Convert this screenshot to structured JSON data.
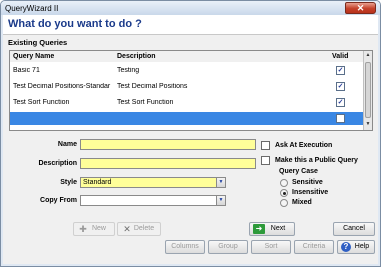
{
  "window": {
    "title": "QueryWizard II",
    "close_label": "✕"
  },
  "header": {
    "title": "What do you want to do ?"
  },
  "existing_queries": {
    "group_label": "Existing Queries",
    "columns": [
      "Query Name",
      "Description",
      "Valid"
    ],
    "rows": [
      {
        "name": "Basic 71",
        "description": "Testing",
        "valid": true
      },
      {
        "name": "Test Decimal Positions-Standar",
        "description": "Test Decimal Positions",
        "valid": true
      },
      {
        "name": "Test Sort Function",
        "description": "Test Sort Function",
        "valid": true
      },
      {
        "name": "",
        "description": "",
        "valid": false,
        "selected": true
      }
    ],
    "check_mark": "✓"
  },
  "form": {
    "name_label": "Name",
    "name_value": "",
    "description_label": "Description",
    "description_value": "",
    "style_label": "Style",
    "style_value": "Standard",
    "copy_from_label": "Copy From",
    "copy_from_value": ""
  },
  "options": {
    "ask_at_execution": "Ask At Execution",
    "public_query": "Make this a Public Query",
    "query_case_label": "Query Case",
    "query_case_options": [
      "Sensitive",
      "Insensitive",
      "Mixed"
    ],
    "query_case_selected": "Insensitive"
  },
  "buttons": {
    "new": "New",
    "delete": "Delete",
    "next": "Next",
    "cancel": "Cancel",
    "columns": "Columns",
    "group": "Group",
    "sort": "Sort",
    "criteria": "Criteria",
    "help": "Help"
  },
  "colors": {
    "accent": "#1a3a8a",
    "selection": "#3a87e4",
    "required_field": "#ffff99",
    "close": "#c4412a"
  }
}
